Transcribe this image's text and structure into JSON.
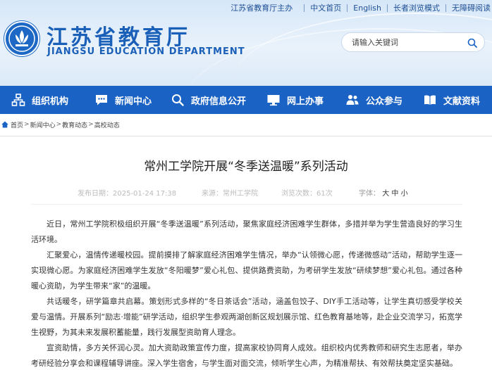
{
  "topbar": {
    "owner": "江苏省教育厅主办",
    "links": [
      "中文首页",
      "English",
      "长者浏览模式",
      "无障碍阅读"
    ]
  },
  "brand": {
    "title": "江苏省教育厅",
    "subtitle": "JIANGSU EDUCATION DEPARTMENT"
  },
  "search": {
    "placeholder": "请输入关键词",
    "value": ""
  },
  "nav": [
    {
      "label": "组织机构",
      "icon": "org-chart-icon"
    },
    {
      "label": "新闻中心",
      "icon": "chat-bubble-icon"
    },
    {
      "label": "政府信息公开",
      "icon": "search-doc-icon"
    },
    {
      "label": "网上办事",
      "icon": "monitor-icon"
    },
    {
      "label": "公众参与",
      "icon": "people-icon"
    },
    {
      "label": "文献资料",
      "icon": "book-icon"
    }
  ],
  "breadcrumb": [
    "首页",
    "新闻中心",
    "教育动态",
    "高校动态"
  ],
  "article": {
    "title": "常州工学院开展“冬季送温暖”系列活动",
    "date": "发布日期：2025-01-24 17:38",
    "source": "来源：常州工学院",
    "views": "浏览次数：61次",
    "font_size_label": "字体：",
    "font_sizes": [
      "大",
      "中",
      "小"
    ],
    "paragraphs": [
      "近日，常州工学院积极组织开展“冬季送温暖”系列活动，聚焦家庭经济困难学生群体，多措并举为学生营造良好的学习生活环境。",
      "汇聚爱心，温情传递暖校园。提前摸排了解家庭经济困难学生情况，举办“认领微心愿，传递微感动”活动，帮助学生逐一实现微心愿。为家庭经济困难学生发放“冬阳暖梦”爱心礼包、提供路费资助，为考研学生发放“研续梦想”爱心礼包。通过各种暖心资助，为学生带来“家”的温暖。",
      "共话暖冬，研学篇章共启幕。策划形式多样的“冬日茶话会”活动，涵盖包饺子、DIY手工活动等，让学生真切感受学校关爱与温情。开展系列“励志·增能”研学活动，组织学生参观两湖创新区规划展示馆、红色教育基地等，赴企业交流学习，拓宽学生视野，为其未来发展积蓄能量，践行发展型资助育人理念。",
      "宣资助情，多方关怀润心灵。加大资助政策宣传力度，提高家校协同育人成效。组织校内优秀教师和研究生志愿者，举办考研经验分享会和课程辅导讲座。深入学生宿舍，与学生面对面交流，倾听学生心声，为精准帮扶、有效帮扶奠定坚实基础。"
    ]
  },
  "colors": {
    "brand_blue": "#1a62c4",
    "title_blue": "#1a5fb8"
  }
}
